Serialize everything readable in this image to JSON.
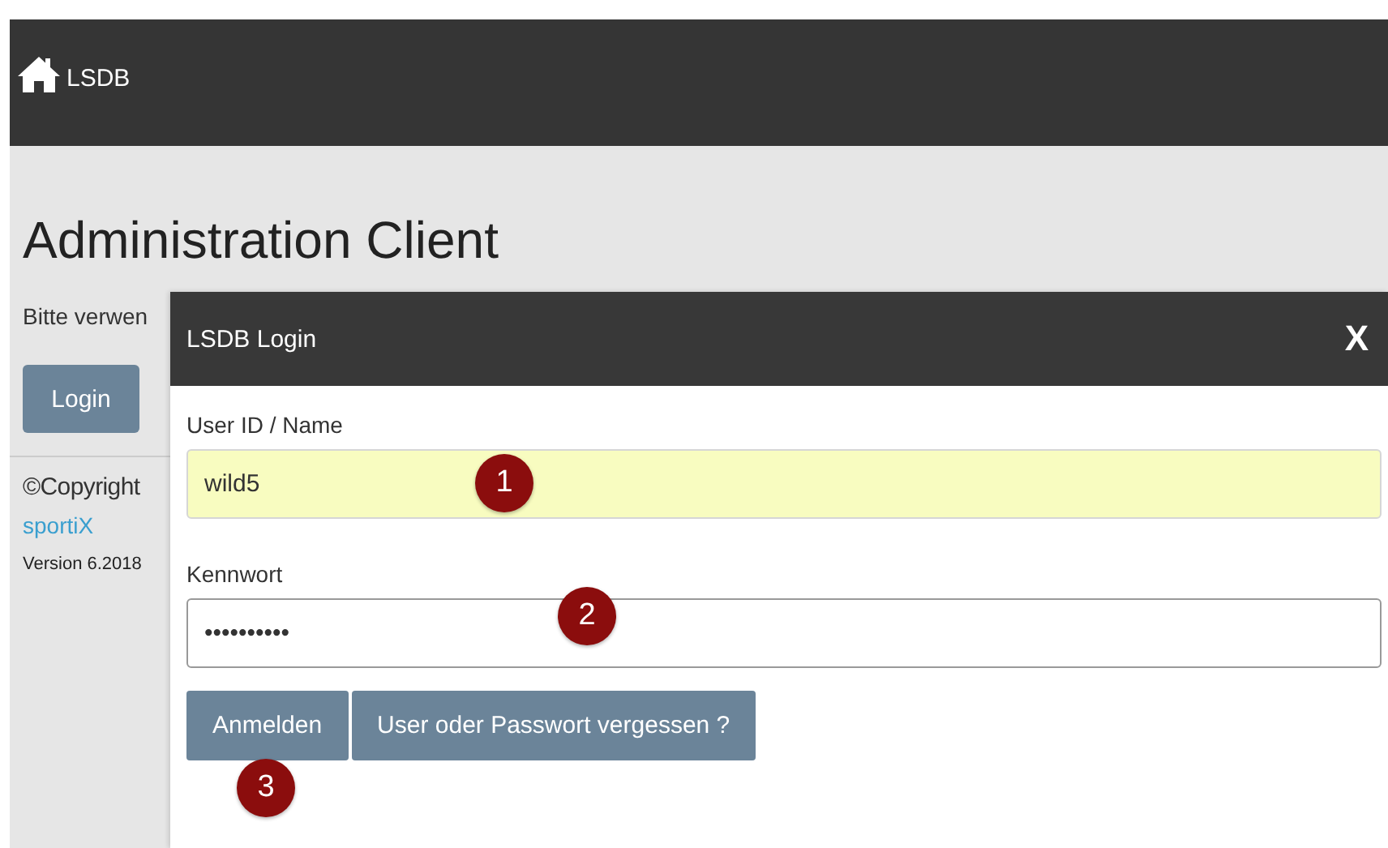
{
  "navbar": {
    "brand": "LSDB"
  },
  "page": {
    "heading": "Administration Client",
    "intro": "Bitte verwen",
    "login_button": "Login",
    "copyright": "©Copyright",
    "company_link": "sportiX",
    "version": "Version 6.2018"
  },
  "dialog": {
    "title": "LSDB Login",
    "close": "X",
    "fields": [
      {
        "label": "User ID / Name",
        "value": "wild5",
        "autofilled": true,
        "focused": false
      },
      {
        "label": "Kennwort",
        "value": "••••••••••",
        "autofilled": false,
        "focused": true
      }
    ],
    "buttons": [
      "Anmelden",
      "User oder Passwort vergessen ?"
    ]
  },
  "annotations": [
    "1",
    "2",
    "3"
  ]
}
